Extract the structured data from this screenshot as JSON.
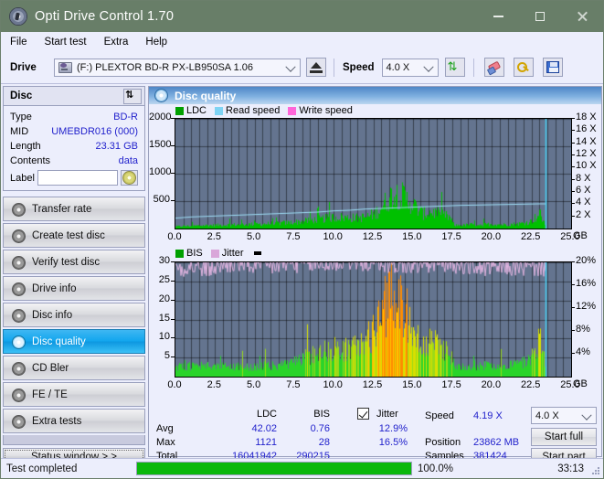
{
  "window": {
    "title": "Opti Drive Control 1.70",
    "icon": "disc-icon",
    "buttons": {
      "minimize": "minimize-icon",
      "maximize": "maximize-icon",
      "close": "close-icon"
    },
    "titlebar_color": "#687e68"
  },
  "menu": {
    "items": [
      "File",
      "Start test",
      "Extra",
      "Help"
    ]
  },
  "toolbar": {
    "drive_label": "Drive",
    "drive_value": "(F:)  PLEXTOR BD-R  PX-LB950SA 1.06",
    "eject_icon": "eject-icon",
    "speed_label": "Speed",
    "speed_value": "4.0 X",
    "refresh_icon": "refresh-icon",
    "erase_icon": "eraser-icon",
    "key_icon": "key-icon",
    "save_icon": "save-icon"
  },
  "disc_panel": {
    "title": "Disc",
    "refresh_icon": "refresh-icon",
    "rows": [
      {
        "key": "Type",
        "value": "BD-R"
      },
      {
        "key": "MID",
        "value": "UMEBDR016 (000)"
      },
      {
        "key": "Length",
        "value": "23.31 GB"
      },
      {
        "key": "Contents",
        "value": "data"
      }
    ],
    "label_key": "Label",
    "label_value": "",
    "label_placeholder": "",
    "disc_icon": "cd-icon"
  },
  "nav": {
    "items": [
      {
        "label": "Transfer rate",
        "selected": false
      },
      {
        "label": "Create test disc",
        "selected": false
      },
      {
        "label": "Verify test disc",
        "selected": false
      },
      {
        "label": "Drive info",
        "selected": false
      },
      {
        "label": "Disc info",
        "selected": false
      },
      {
        "label": "Disc quality",
        "selected": true
      },
      {
        "label": "CD Bler",
        "selected": false
      },
      {
        "label": "FE / TE",
        "selected": false
      },
      {
        "label": "Extra tests",
        "selected": false
      }
    ],
    "status_window_label": "Status window > >"
  },
  "main": {
    "title": "Disc quality",
    "icon": "disc-quality-icon"
  },
  "stats": {
    "col_ldc": "LDC",
    "col_bis": "BIS",
    "jitter_label": "Jitter",
    "jitter_checked": true,
    "rows": [
      {
        "key": "Avg",
        "ldc": "42.02",
        "bis": "0.76",
        "jitter": "12.9%"
      },
      {
        "key": "Max",
        "ldc": "1121",
        "bis": "28",
        "jitter": "16.5%"
      },
      {
        "key": "Total",
        "ldc": "16041942",
        "bis": "290215",
        "jitter": ""
      }
    ],
    "speed_key": "Speed",
    "speed_value": "4.19 X",
    "position_key": "Position",
    "position_value": "23862 MB",
    "samples_key": "Samples",
    "samples_value": "381424",
    "speed_select": "4.0 X",
    "start_full": "Start full",
    "start_part": "Start part"
  },
  "statusbar": {
    "message": "Test completed",
    "percent_label": "100.0%",
    "percent_value": 100,
    "elapsed": "33:13"
  },
  "chart_data": [
    {
      "type": "area",
      "id": "ldc-chart",
      "title": "",
      "xlabel": "GB",
      "ylabel": "LDC",
      "legend": [
        {
          "name": "LDC",
          "color": "#00a000"
        },
        {
          "name": "Read speed",
          "color": "#7fd4f4"
        },
        {
          "name": "Write speed",
          "color": "#ff66d9"
        }
      ],
      "legend_position": "top-left",
      "grid": true,
      "xlim": [
        0,
        25.0
      ],
      "xticks": [
        "0.0",
        "2.5",
        "5.0",
        "7.5",
        "10.0",
        "12.5",
        "15.0",
        "17.5",
        "20.0",
        "22.5",
        "25.0"
      ],
      "ylim": [
        0,
        2000
      ],
      "yticks": [
        500,
        1000,
        1500,
        2000
      ],
      "y2label": "X",
      "y2lim": [
        0,
        18
      ],
      "y2ticks": [
        "2 X",
        "4 X",
        "6 X",
        "8 X",
        "10 X",
        "12 X",
        "14 X",
        "16 X",
        "18 X"
      ],
      "cursor_x": 23.4,
      "series": [
        {
          "name": "LDC",
          "color": "#00c000",
          "x": [
            0.0,
            0.6,
            1.2,
            1.8,
            2.4,
            3.0,
            3.6,
            4.2,
            4.8,
            5.4,
            6.0,
            6.6,
            7.2,
            7.8,
            8.4,
            9.0,
            9.6,
            10.2,
            10.8,
            11.4,
            12.0,
            12.6,
            13.2,
            13.8,
            14.4,
            15.0,
            15.6,
            16.2,
            16.8,
            17.3,
            17.6,
            18.2,
            18.8,
            19.4,
            20.0,
            20.6,
            21.2,
            21.8,
            22.4,
            23.0,
            23.4
          ],
          "values": [
            45,
            55,
            60,
            70,
            75,
            80,
            85,
            90,
            95,
            100,
            110,
            120,
            130,
            150,
            175,
            200,
            230,
            255,
            240,
            235,
            250,
            330,
            560,
            790,
            700,
            520,
            330,
            370,
            300,
            250,
            70,
            75,
            90,
            85,
            100,
            85,
            95,
            110,
            150,
            320,
            60
          ]
        },
        {
          "name": "Read speed",
          "color": "#9fe0f7",
          "x": [
            0.0,
            1.0,
            2.0,
            3.0,
            4.0,
            5.0,
            6.0,
            7.0,
            8.0,
            9.0,
            10.0,
            11.0,
            12.0,
            13.0,
            14.0,
            15.0,
            16.0,
            17.0,
            18.0,
            19.0,
            20.0,
            21.0,
            22.0,
            23.0,
            23.4
          ],
          "values": [
            1.7,
            1.9,
            2.0,
            2.1,
            2.2,
            2.3,
            2.4,
            2.5,
            2.6,
            2.7,
            2.9,
            3.0,
            3.2,
            3.3,
            3.4,
            3.5,
            3.6,
            3.7,
            3.8,
            3.85,
            3.9,
            3.95,
            4.0,
            4.05,
            4.05
          ]
        }
      ]
    },
    {
      "type": "area",
      "id": "bis-jitter-chart",
      "title": "",
      "xlabel": "GB",
      "ylabel": "BIS",
      "legend": [
        {
          "name": "BIS",
          "color": "#00a000"
        },
        {
          "name": "Jitter",
          "color": "#d9a6d9"
        }
      ],
      "legend_position": "top-left",
      "grid": true,
      "xlim": [
        0,
        25.0
      ],
      "xticks": [
        "0.0",
        "2.5",
        "5.0",
        "7.5",
        "10.0",
        "12.5",
        "15.0",
        "17.5",
        "20.0",
        "22.5",
        "25.0"
      ],
      "ylim": [
        0,
        30
      ],
      "yticks": [
        5,
        10,
        15,
        20,
        25,
        30
      ],
      "y2label": "%",
      "y2lim": [
        0,
        20
      ],
      "y2ticks": [
        "4%",
        "8%",
        "12%",
        "16%",
        "20%"
      ],
      "cursor_x": 23.4,
      "series": [
        {
          "name": "BIS",
          "color": "#2ad42a",
          "x": [
            0.0,
            0.6,
            1.2,
            1.8,
            2.4,
            3.0,
            3.6,
            4.2,
            4.8,
            5.4,
            6.0,
            6.6,
            7.2,
            7.8,
            8.4,
            9.0,
            9.6,
            10.2,
            10.8,
            11.4,
            12.0,
            12.6,
            13.2,
            13.8,
            14.4,
            15.0,
            15.6,
            16.2,
            16.8,
            17.3,
            17.6,
            18.2,
            18.8,
            19.4,
            20.0,
            20.6,
            21.2,
            21.8,
            22.4,
            23.0,
            23.4
          ],
          "values": [
            3.2,
            3.4,
            3.2,
            3.3,
            3.1,
            3.3,
            3.2,
            3.4,
            3.2,
            3.3,
            3.4,
            3.6,
            4.0,
            5.0,
            6.5,
            8.0,
            8.5,
            9.0,
            8.5,
            9.5,
            11.0,
            15.0,
            22.0,
            26.0,
            22.0,
            15.0,
            9.0,
            11.0,
            9.5,
            8.0,
            3.2,
            3.3,
            3.6,
            3.4,
            3.8,
            3.5,
            3.9,
            4.2,
            5.5,
            12.0,
            3.0
          ]
        },
        {
          "name": "Jitter",
          "color": "#dfb3df",
          "x": [
            0.0,
            1.0,
            2.0,
            3.0,
            4.0,
            5.0,
            6.0,
            7.0,
            8.0,
            9.0,
            10.0,
            11.0,
            12.0,
            13.0,
            14.0,
            15.0,
            16.0,
            17.0,
            18.0,
            19.0,
            20.0,
            21.0,
            22.0,
            23.0,
            23.4
          ],
          "values": [
            19.0,
            19.2,
            18.8,
            19.5,
            19.8,
            19.4,
            19.2,
            19.6,
            19.8,
            19.5,
            19.7,
            20.2,
            20.0,
            19.8,
            19.5,
            19.3,
            19.6,
            19.9,
            19.5,
            19.2,
            18.9,
            19.2,
            19.0,
            19.1,
            19.0
          ]
        }
      ]
    }
  ]
}
